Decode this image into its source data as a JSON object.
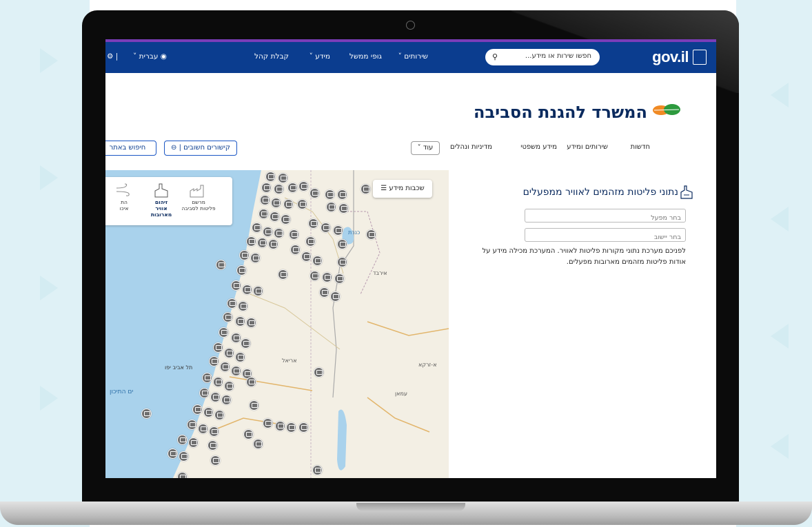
{
  "gov_header": {
    "logo_text": "gov.il",
    "search_placeholder": "חפשו שירות או מידע...",
    "nav": [
      "שירותים",
      "גופי ממשל",
      "מידע",
      "קבלת קהל"
    ],
    "language": "עברית"
  },
  "ministry": {
    "title": "המשרד להגנת הסביבה",
    "menu": [
      "חדשות",
      "שירותים ומידע",
      "מידע משפטי",
      "מדיניות ונהלים"
    ],
    "more": "עוד",
    "important_links": "קישורים חשובים",
    "site_search": "חיפוש באתר"
  },
  "panel": {
    "title": "נתוני פליטות מזהמים לאוויר ממפעלים",
    "factory_placeholder": "בחר מפעל",
    "settlement_placeholder": "בחר יישוב",
    "description": "לפניכם מערכת נתוני מקורות פליטות לאוויר. המערכת מכילה מידע על אודות פליטות מזהמים מארובות מפעלים."
  },
  "map": {
    "layers_button": "שכבות מידע",
    "categories": [
      {
        "line1": "מרשם",
        "line2": "פליטות לסביבה",
        "icon": "factory-icon"
      },
      {
        "line1": "זיהום",
        "line2": "אוויר מארובות",
        "icon": "chimney-icon"
      },
      {
        "line1": "הת",
        "line2": "איכו",
        "icon": "wind-icon"
      }
    ],
    "labels": {
      "kinneret": "כנרת",
      "irbid": "אירבד",
      "tel_aviv": "תל אביב יפו",
      "mediterranean": "ים התיכון",
      "ariel": "אריאל",
      "zarqa": "א-זרקא",
      "amman": "עמאן"
    }
  },
  "colors": {
    "gov_blue": "#0b3d8f",
    "ministry_navy": "#0a2a5e",
    "accent_strip": "#7a3db8",
    "pin": "#6e6e6e"
  }
}
